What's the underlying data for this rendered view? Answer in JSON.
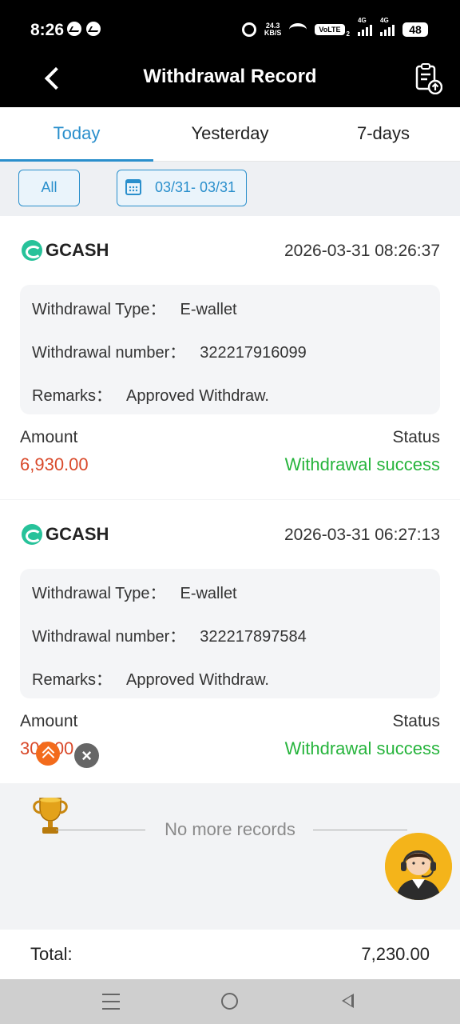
{
  "status_bar": {
    "time": "8:26",
    "net_speed_top": "24.3",
    "net_speed_bottom": "KB/S",
    "volte": "VoLTE",
    "sim_index": "2",
    "net1": "4G",
    "net2": "4G",
    "battery": "48",
    "icons": [
      "messenger-icon",
      "messenger-icon",
      "alarm-icon",
      "wifi-icon",
      "signal-icon",
      "battery-icon"
    ]
  },
  "header": {
    "title": "Withdrawal Record",
    "back_icon": "chevron-left-icon",
    "action_icon": "clipboard-upload-icon"
  },
  "tabs": [
    {
      "label": "Today",
      "active": true
    },
    {
      "label": "Yesterday",
      "active": false
    },
    {
      "label": "7-days",
      "active": false
    }
  ],
  "filter": {
    "all_label": "All",
    "date_label": "03/31- 03/31",
    "date_icon": "calendar-icon"
  },
  "records": [
    {
      "channel": "GCASH",
      "timestamp": "2026-03-31 08:26:37",
      "type_label": "Withdrawal Type：",
      "type_value": "E-wallet",
      "number_label": "Withdrawal number：",
      "number_value": "322217916099",
      "remarks_label": "Remarks：",
      "remarks_value": "Approved Withdraw.",
      "amount_label": "Amount",
      "amount_value": "6,930.00",
      "status_label": "Status",
      "status_value": "Withdrawal success"
    },
    {
      "channel": "GCASH",
      "timestamp": "2026-03-31 06:27:13",
      "type_label": "Withdrawal Type：",
      "type_value": "E-wallet",
      "number_label": "Withdrawal number：",
      "number_value": "322217897584",
      "remarks_label": "Remarks：",
      "remarks_value": "Approved Withdraw.",
      "amount_label": "Amount",
      "amount_value": "300.00",
      "status_label": "Status",
      "status_value": "Withdrawal success"
    }
  ],
  "footer": {
    "no_more": "No more records",
    "total_label": "Total:",
    "total_value": "7,230.00"
  },
  "colors": {
    "accent": "#2a8fcc",
    "amount": "#d94a2b",
    "success": "#26b43c",
    "gcash": "#27c29a"
  }
}
